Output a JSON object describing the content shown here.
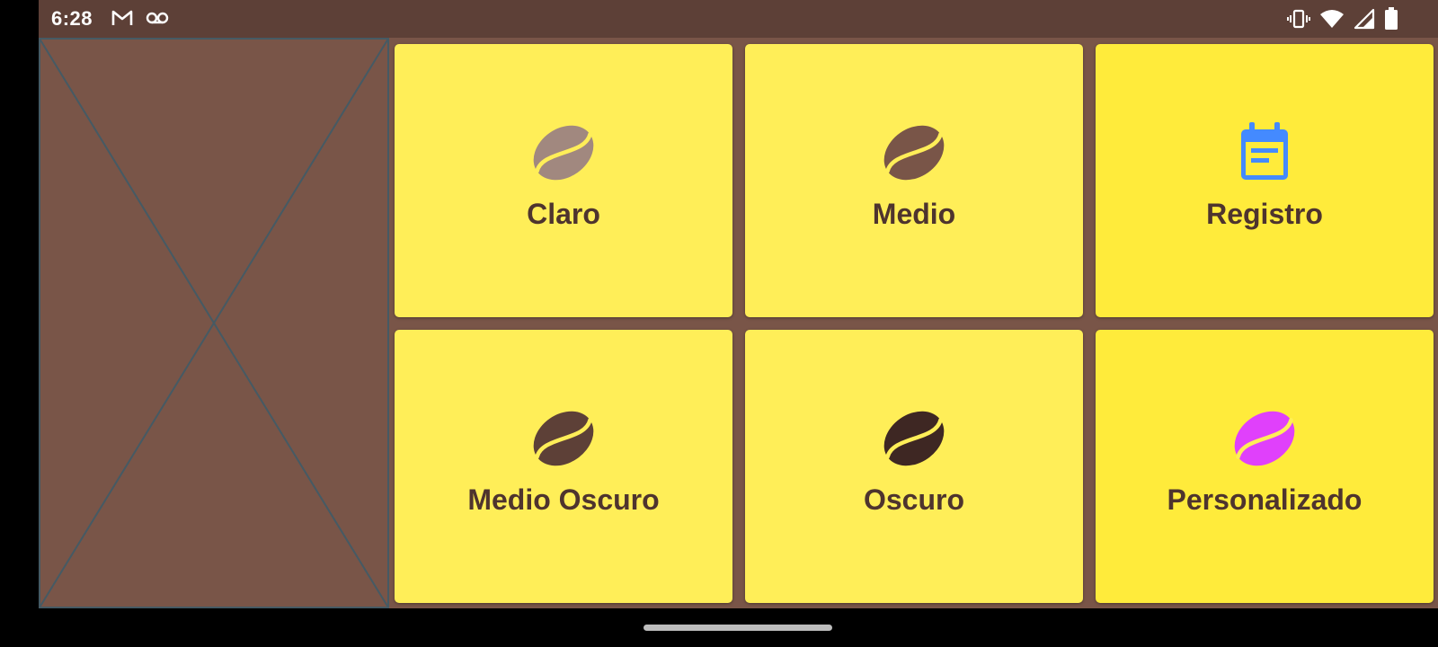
{
  "status_bar": {
    "time": "6:28",
    "left_icons": [
      "gmail-icon",
      "voicemail-icon"
    ],
    "right_icons": [
      "vibrate-icon",
      "wifi-icon",
      "signal-icon",
      "battery-icon"
    ]
  },
  "placeholder": {
    "icon": "image-placeholder"
  },
  "tiles": [
    {
      "label": "Claro",
      "icon": "coffee-bean-icon",
      "icon_color": "#a1887f",
      "bg": "#ffee58"
    },
    {
      "label": "Medio",
      "icon": "coffee-bean-icon",
      "icon_color": "#795548",
      "bg": "#ffee58"
    },
    {
      "label": "Registro",
      "icon": "calendar-icon",
      "icon_color": "#448aff",
      "bg": "#ffeb3b"
    },
    {
      "label": "Medio Oscuro",
      "icon": "coffee-bean-icon",
      "icon_color": "#5d4037",
      "bg": "#ffee58"
    },
    {
      "label": "Oscuro",
      "icon": "coffee-bean-icon",
      "icon_color": "#3e2723",
      "bg": "#ffee58"
    },
    {
      "label": "Personalizado",
      "icon": "coffee-bean-icon",
      "icon_color": "#e040fb",
      "bg": "#ffeb3b"
    }
  ],
  "colors": {
    "status_bar": "#5d4037",
    "background": "#795548",
    "label_text": "#4e342e",
    "bean_stripe": "#ffee58"
  },
  "nav_bar": {
    "handle": "home-gesture-handle"
  }
}
